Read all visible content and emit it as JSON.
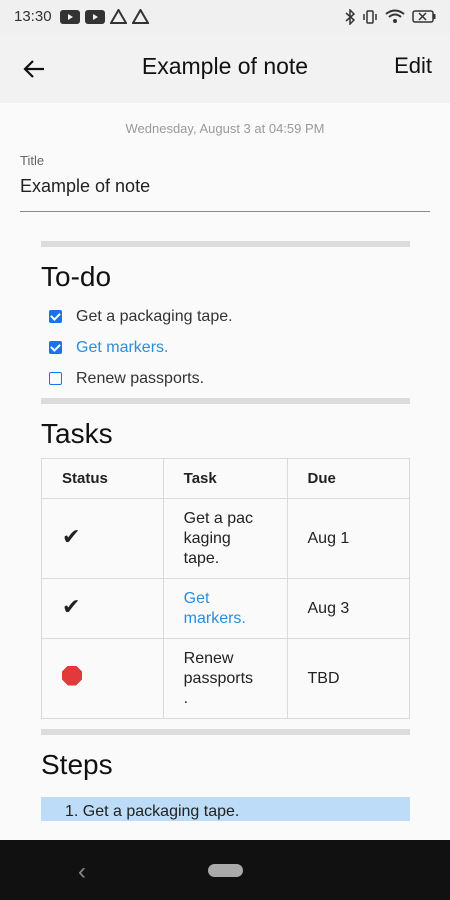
{
  "status_bar": {
    "time": "13:30",
    "icons": [
      "youtube-icon",
      "youtube-icon",
      "drive-icon",
      "drive-icon",
      "bluetooth-icon",
      "vibrate-icon",
      "wifi-icon",
      "battery-icon"
    ]
  },
  "app_bar": {
    "title": "Example of note",
    "back_icon": "arrow-left-icon",
    "edit_label": "Edit"
  },
  "note": {
    "timestamp": "Wednesday, August 3 at 04:59 PM",
    "title_label": "Title",
    "title_value": "Example of note"
  },
  "todo": {
    "heading": "To-do",
    "items": [
      {
        "label": "Get a packaging tape.",
        "checked": true
      },
      {
        "label": "Get markers.",
        "checked": true,
        "link": true
      },
      {
        "label": "Renew passports.",
        "checked": false
      }
    ]
  },
  "tasks": {
    "heading": "Tasks",
    "columns": [
      "Status",
      "Task",
      "Due"
    ],
    "rows": [
      {
        "status": "✔",
        "task_lines": [
          "Get a pac",
          "kaging",
          "tape."
        ],
        "due": "Aug 1"
      },
      {
        "status": "✔",
        "task_lines": [
          "Get",
          "markers."
        ],
        "due": "Aug 3",
        "link": true
      },
      {
        "status": "stop-sign-icon",
        "task_lines": [
          "Renew",
          "passports",
          "."
        ],
        "due": "TBD"
      }
    ]
  },
  "steps": {
    "heading": "Steps",
    "first_item": "1.  Get a packaging tape."
  },
  "colors": {
    "accent": "#1a73e8",
    "link": "#2b8de0",
    "stop": "#e03a3a",
    "highlight": "#bcdcf7"
  }
}
